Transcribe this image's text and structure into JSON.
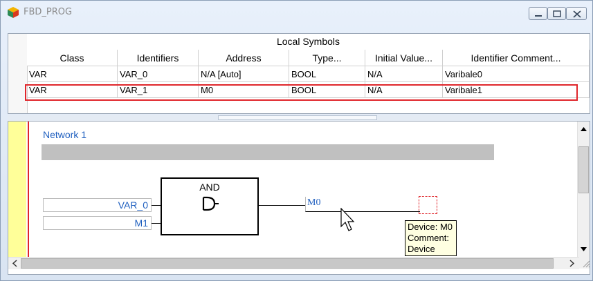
{
  "window": {
    "title": "FBD_PROG"
  },
  "symbols": {
    "section_title": "Local Symbols",
    "columns": [
      "Class",
      "Identifiers",
      "Address",
      "Type...",
      "Initial Value...",
      "Identifier Comment..."
    ],
    "rows": [
      [
        "VAR",
        "VAR_0",
        "N/A [Auto]",
        "BOOL",
        "N/A",
        "Varibale0"
      ],
      [
        "VAR",
        "VAR_1",
        "M0",
        "BOOL",
        "N/A",
        "Varibale1"
      ]
    ]
  },
  "editor": {
    "network_label": "Network 1",
    "block": {
      "name": "AND",
      "symbol": "D"
    },
    "inputs": [
      "VAR_0",
      "M1"
    ],
    "output": "M0",
    "tooltip": {
      "device": "Device: M0",
      "comment": "Comment:",
      "device_comment": "Device"
    }
  },
  "colors": {
    "highlight": "#e0262b",
    "identifier_text": "#1f5fbf",
    "margin": "#ffff99"
  }
}
